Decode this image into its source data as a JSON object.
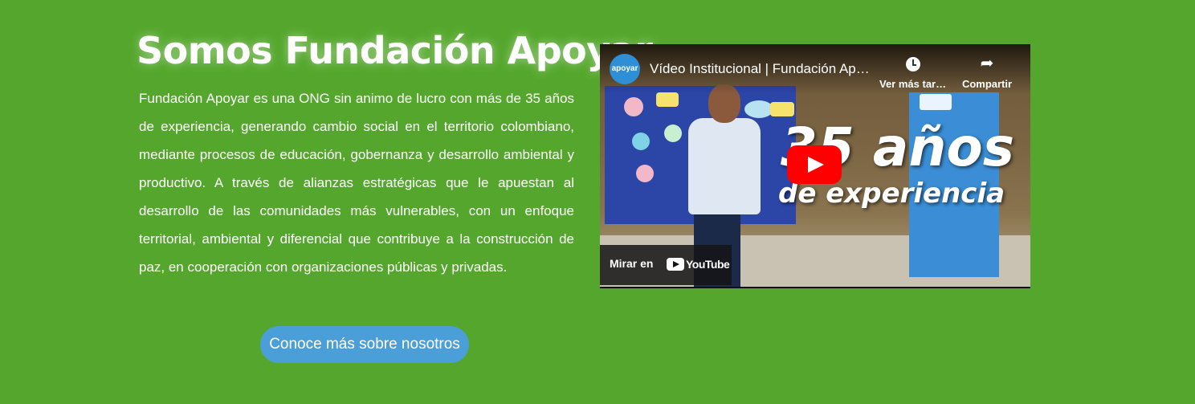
{
  "section": {
    "title": "Somos Fundación Apoyar",
    "paragraph": "Fundación Apoyar es una ONG sin animo de lucro con más de 35 años de experiencia, generando cambio social en el territorio colombiano, mediante procesos de educación, gobernanza y desarrollo ambiental y productivo. A través de alianzas estratégicas que le apuestan al desarrollo de las comunidades más vulnerables, con un enfoque territorial, ambiental y diferencial que contribuye a la construcción de paz, en cooperación con organizaciones públicas y privadas.",
    "cta_label": "Conoce más sobre nosotros"
  },
  "video": {
    "channel_logo_text": "apoyar",
    "title": "Vídeo Institucional | Fundación Apoyar",
    "watch_later_label": "Ver más tarde",
    "share_label": "Compartir",
    "thumbnail_headline": "35 años",
    "thumbnail_subline": "de experiencia",
    "watch_on_label": "Mirar en",
    "youtube_brand": "YouTube"
  },
  "colors": {
    "background": "#54a72c",
    "button": "#4a9fd8",
    "play_button": "#ff0000"
  },
  "icons": [
    "clock-icon",
    "share-icon",
    "play-icon",
    "youtube-logo-icon"
  ]
}
